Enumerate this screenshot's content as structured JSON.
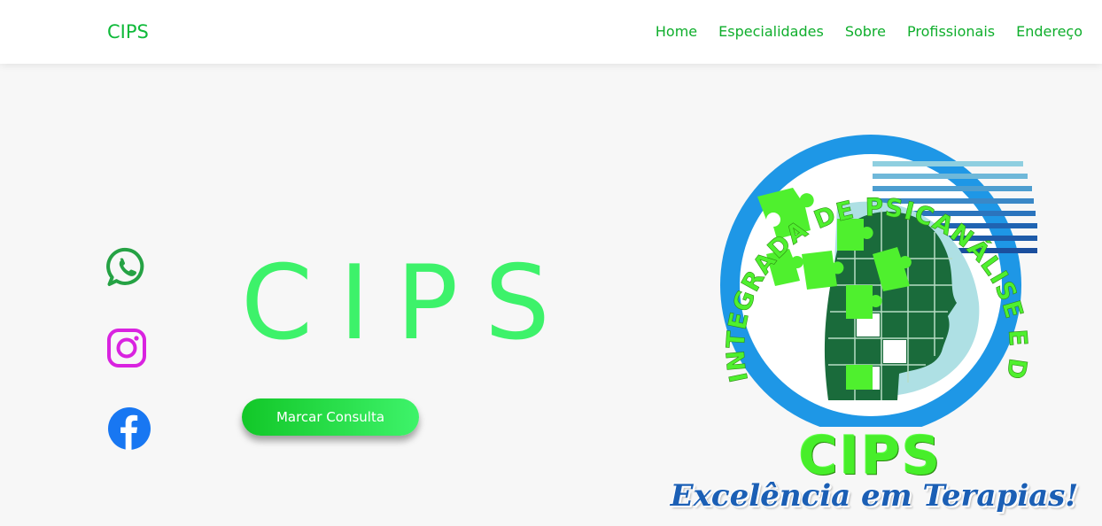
{
  "nav": {
    "brand": "CIPS",
    "links": [
      "Home",
      "Especialidades",
      "Sobre",
      "Profissionais",
      "Endereço"
    ]
  },
  "social": {
    "whatsapp_icon": "whatsapp-icon",
    "instagram_icon": "instagram-icon",
    "facebook_icon": "facebook-icon"
  },
  "hero": {
    "title": "CIPS",
    "cta_label": "Marcar Consulta"
  },
  "logo": {
    "arc_text": "CLÍNICA INTEGRADA DE PSICANÁLISE E DA SAÚDE",
    "name": "CIPS",
    "tagline": "Excelência em Terapias!"
  },
  "colors": {
    "brand_green": "#0fba3a",
    "hero_green": "#3df26a",
    "logo_green": "#47ee2a",
    "logo_blue": "#1b5fb5",
    "whatsapp": "#25a244",
    "instagram": "#d923e0",
    "facebook": "#1877f2"
  }
}
